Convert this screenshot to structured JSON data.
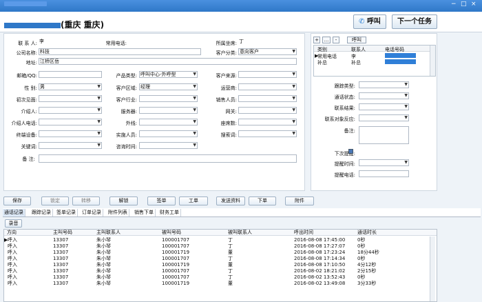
{
  "header": {
    "caller_line": "(重庆 重庆)",
    "call_button": "呼叫",
    "next_button": "下一个任务"
  },
  "form": {
    "contact": {
      "label": "联 系 人:",
      "value": "李"
    },
    "phone": {
      "label": "常用电话:",
      "value": ""
    },
    "seat": {
      "label": "所属坐席:",
      "value": "丁"
    },
    "company": {
      "label": "公司名称:",
      "value": "科技"
    },
    "customer_category": {
      "label": "客户分类:",
      "value": "意向客户"
    },
    "address": {
      "label": "地址:",
      "value": "江桥区岳"
    },
    "email": {
      "label": "邮箱/QQ:",
      "value": ""
    },
    "product_type": {
      "label": "产品类型:",
      "value": "呼叫中心-外呼型"
    },
    "customer_source": {
      "label": "客户来源:",
      "value": ""
    },
    "gender": {
      "label": "性 别:",
      "value": "男"
    },
    "customer_region": {
      "label": "客户区域:",
      "value": "经理"
    },
    "operator": {
      "label": "运营商:",
      "value": ""
    },
    "first_visit": {
      "label": "初次见面:",
      "value": ""
    },
    "industry": {
      "label": "客户行业:",
      "value": ""
    },
    "sales_person": {
      "label": "销售人员:",
      "value": ""
    },
    "referrer": {
      "label": "介绍人:",
      "value": ""
    },
    "server": {
      "label": "服务器:",
      "value": ""
    },
    "gateway": {
      "label": "网关:",
      "value": ""
    },
    "referrer_phone": {
      "label": "介绍人电话:",
      "value": ""
    },
    "external_line": {
      "label": "外线:",
      "value": ""
    },
    "seat_count": {
      "label": "座席数:",
      "value": ""
    },
    "terminal": {
      "label": "终端设备:",
      "value": ""
    },
    "implementer": {
      "label": "实施人员:",
      "value": ""
    },
    "search_term": {
      "label": "搜索词:",
      "value": ""
    },
    "keyword": {
      "label": "关键词:",
      "value": ""
    },
    "consult_time": {
      "label": "咨询时间:",
      "value": ""
    },
    "remark": {
      "label": "备 注:",
      "value": ""
    }
  },
  "right_panel": {
    "plus": "+",
    "ellipsis": "...",
    "minus": "-",
    "call": "呼叫",
    "grid_headers": [
      "类别",
      "联系人",
      "电话号码"
    ],
    "grid_rows": [
      {
        "category": "常用电话",
        "contact": "李",
        "phone": ""
      },
      {
        "category": "补总",
        "contact": "补总",
        "phone": ""
      }
    ],
    "follow_type": {
      "label": "跟踪类型:",
      "value": ""
    },
    "call_status": {
      "label": "通话状态:",
      "value": ""
    },
    "contact_result": {
      "label": "联系结果:",
      "value": ""
    },
    "reaction": {
      "label": "联系对象反应:",
      "value": ""
    },
    "remark": {
      "label": "备注:",
      "value": ""
    },
    "next_reminder": {
      "label": "下次提醒:",
      "checked": true
    },
    "reminder_time": {
      "label": "提醒时间:",
      "value": ""
    },
    "reminder_phone": {
      "label": "提醒电话:",
      "value": ""
    }
  },
  "buttons": [
    "保存",
    "锁定",
    "转移",
    "解锁",
    "签单",
    "工单",
    "发送资料",
    "下单",
    "附件"
  ],
  "tabs": [
    "通话记录",
    "跟踪记录",
    "签单记录",
    "订单记录",
    "附件列表",
    "销售下单",
    "财务工单"
  ],
  "record_button": "录音",
  "call_table": {
    "headers": [
      "方向",
      "主叫号码",
      "主叫联系人",
      "被叫号码",
      "被叫联系人",
      "呼出时间",
      "通话时长"
    ],
    "rows": [
      {
        "direction": "呼入",
        "caller_number": "13307",
        "caller_contact": "朱小琴",
        "called_number": "100001707",
        "called_contact": "丁",
        "time": "2016-08-08 17:45:00",
        "duration": "0秒"
      },
      {
        "direction": "呼入",
        "caller_number": "13307",
        "caller_contact": "朱小琴",
        "called_number": "100001707",
        "called_contact": "丁",
        "time": "2016-08-08 17:27:07",
        "duration": "0秒"
      },
      {
        "direction": "呼入",
        "caller_number": "13307",
        "caller_contact": "朱小琴",
        "called_number": "100001719",
        "called_contact": "董",
        "time": "2016-08-08 17:23:24",
        "duration": "18分44秒"
      },
      {
        "direction": "呼入",
        "caller_number": "13307",
        "caller_contact": "朱小琴",
        "called_number": "100001707",
        "called_contact": "丁",
        "time": "2016-08-08 17:14:34",
        "duration": "0秒"
      },
      {
        "direction": "呼入",
        "caller_number": "13307",
        "caller_contact": "朱小琴",
        "called_number": "100001719",
        "called_contact": "董",
        "time": "2016-08-08 17:10:50",
        "duration": "4分12秒"
      },
      {
        "direction": "呼入",
        "caller_number": "13307",
        "caller_contact": "朱小琴",
        "called_number": "100001707",
        "called_contact": "丁",
        "time": "2016-08-02 18:21:02",
        "duration": "2分15秒"
      },
      {
        "direction": "呼入",
        "caller_number": "13307",
        "caller_contact": "朱小琴",
        "called_number": "100001707",
        "called_contact": "丁",
        "time": "2016-08-02 13:52:43",
        "duration": "0秒"
      },
      {
        "direction": "呼入",
        "caller_number": "13307",
        "caller_contact": "朱小琴",
        "called_number": "100001719",
        "called_contact": "董",
        "time": "2016-08-02 13:49:08",
        "duration": "3分33秒"
      }
    ]
  }
}
